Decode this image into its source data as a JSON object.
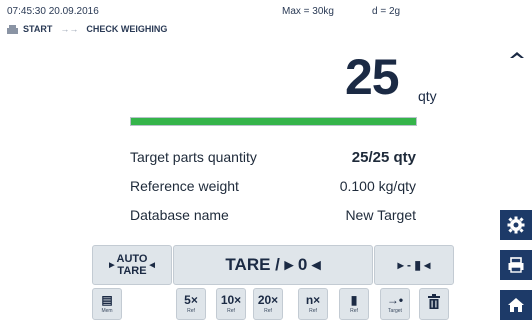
{
  "status": {
    "time": "07:45:30",
    "date": "20.09.2016",
    "max": "Max = 30kg",
    "division": "d = 2g"
  },
  "breadcrumb": {
    "start": "START",
    "current": "CHECK WEIGHING"
  },
  "display": {
    "value": "25",
    "unit": "qty",
    "progress_fraction": 1.0
  },
  "info": [
    {
      "label": "Target parts quantity",
      "value": "25/25 qty"
    },
    {
      "label": "Reference weight",
      "value": "0.100 kg/qty"
    },
    {
      "label": "Database name",
      "value": "New Target"
    }
  ],
  "keys": {
    "auto_tare_line1": "AUTO",
    "auto_tare_line2": "TARE",
    "tare": "TARE / ▸ 0 ◂",
    "zero": "▸ - ▮ ◂"
  },
  "softkeys": [
    {
      "icon": "memory-icon",
      "main": "▤",
      "sub": "Mem"
    },
    {
      "icon": "ref5-icon",
      "main": "5×",
      "sub": "Ref"
    },
    {
      "icon": "ref10-icon",
      "main": "10×",
      "sub": "Ref"
    },
    {
      "icon": "ref20-icon",
      "main": "20×",
      "sub": "Ref"
    },
    {
      "icon": "refn-icon",
      "main": "n×",
      "sub": "Ref"
    },
    {
      "icon": "ref-weight-icon",
      "main": "▮",
      "sub": "Ref"
    },
    {
      "icon": "target-icon",
      "main": "→•",
      "sub": "Target"
    },
    {
      "icon": "trash-icon",
      "main": "",
      "sub": ""
    }
  ],
  "colors": {
    "accent": "#1d3a68",
    "progress": "#35b44a",
    "key_bg": "#dfe5ea"
  }
}
